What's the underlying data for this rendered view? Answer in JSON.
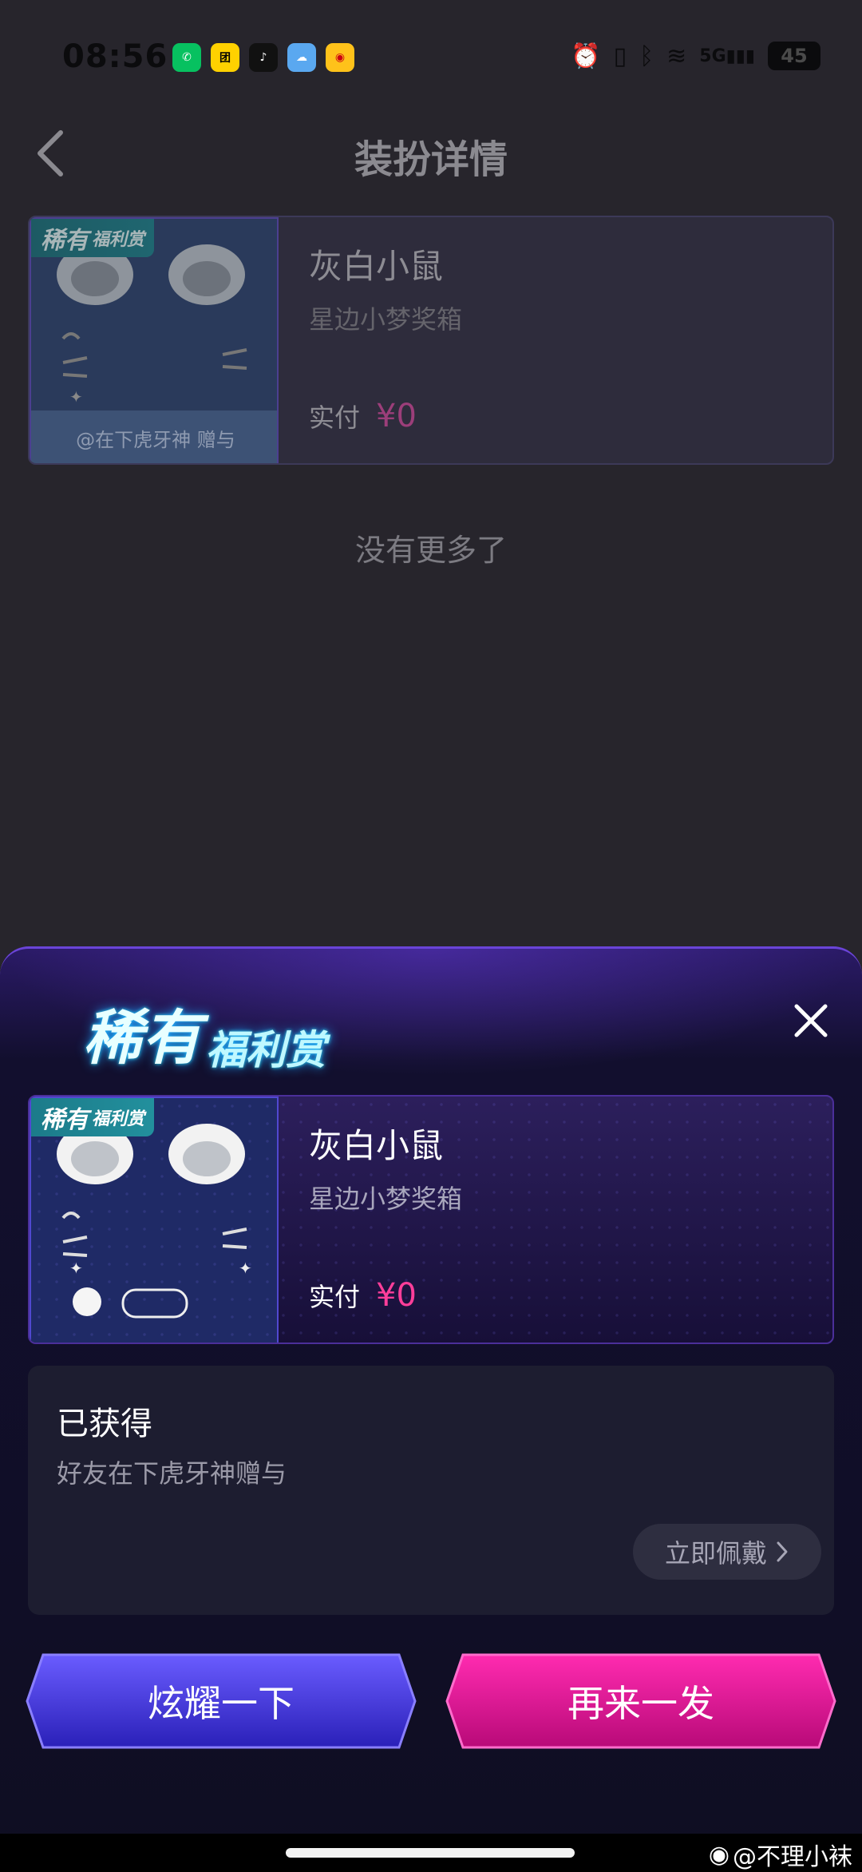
{
  "status_bar": {
    "time": "08:56",
    "apps": [
      {
        "name": "wechat-icon",
        "color": "#07c160",
        "glyph": "✆"
      },
      {
        "name": "meituan-icon",
        "color": "#ffd100",
        "glyph": "团"
      },
      {
        "name": "tiktok-icon",
        "color": "#111111",
        "glyph": "♪"
      },
      {
        "name": "weather-icon",
        "color": "#5aa8f0",
        "glyph": "☁"
      },
      {
        "name": "weibo-icon",
        "color": "#ffc21a",
        "glyph": "◉"
      }
    ],
    "battery": "45",
    "network": "5G"
  },
  "nav": {
    "title": "装扮详情"
  },
  "list_item": {
    "badge_big": "稀有",
    "badge_small": "福利赏",
    "name": "灰白小鼠",
    "source": "星边小梦奖箱",
    "pay_label": "实付",
    "pay_value": "¥0",
    "gift_text": "@在下虎牙神 赠与"
  },
  "no_more": "没有更多了",
  "sheet": {
    "title_big": "稀有",
    "title_small": "福利赏",
    "item": {
      "badge_big": "稀有",
      "badge_small": "福利赏",
      "name": "灰白小鼠",
      "source": "星边小梦奖箱",
      "pay_label": "实付",
      "pay_value": "¥0"
    },
    "obtained": {
      "title": "已获得",
      "desc": "好友在下虎牙神赠与",
      "wear_button": "立即佩戴"
    },
    "buttons": {
      "flaunt": "炫耀一下",
      "again": "再来一发"
    }
  },
  "watermark": "@不理小袜",
  "colors": {
    "accent_pink": "#ff3e9a",
    "flaunt_button": "#4a3de0",
    "again_button": "#e6138f"
  }
}
